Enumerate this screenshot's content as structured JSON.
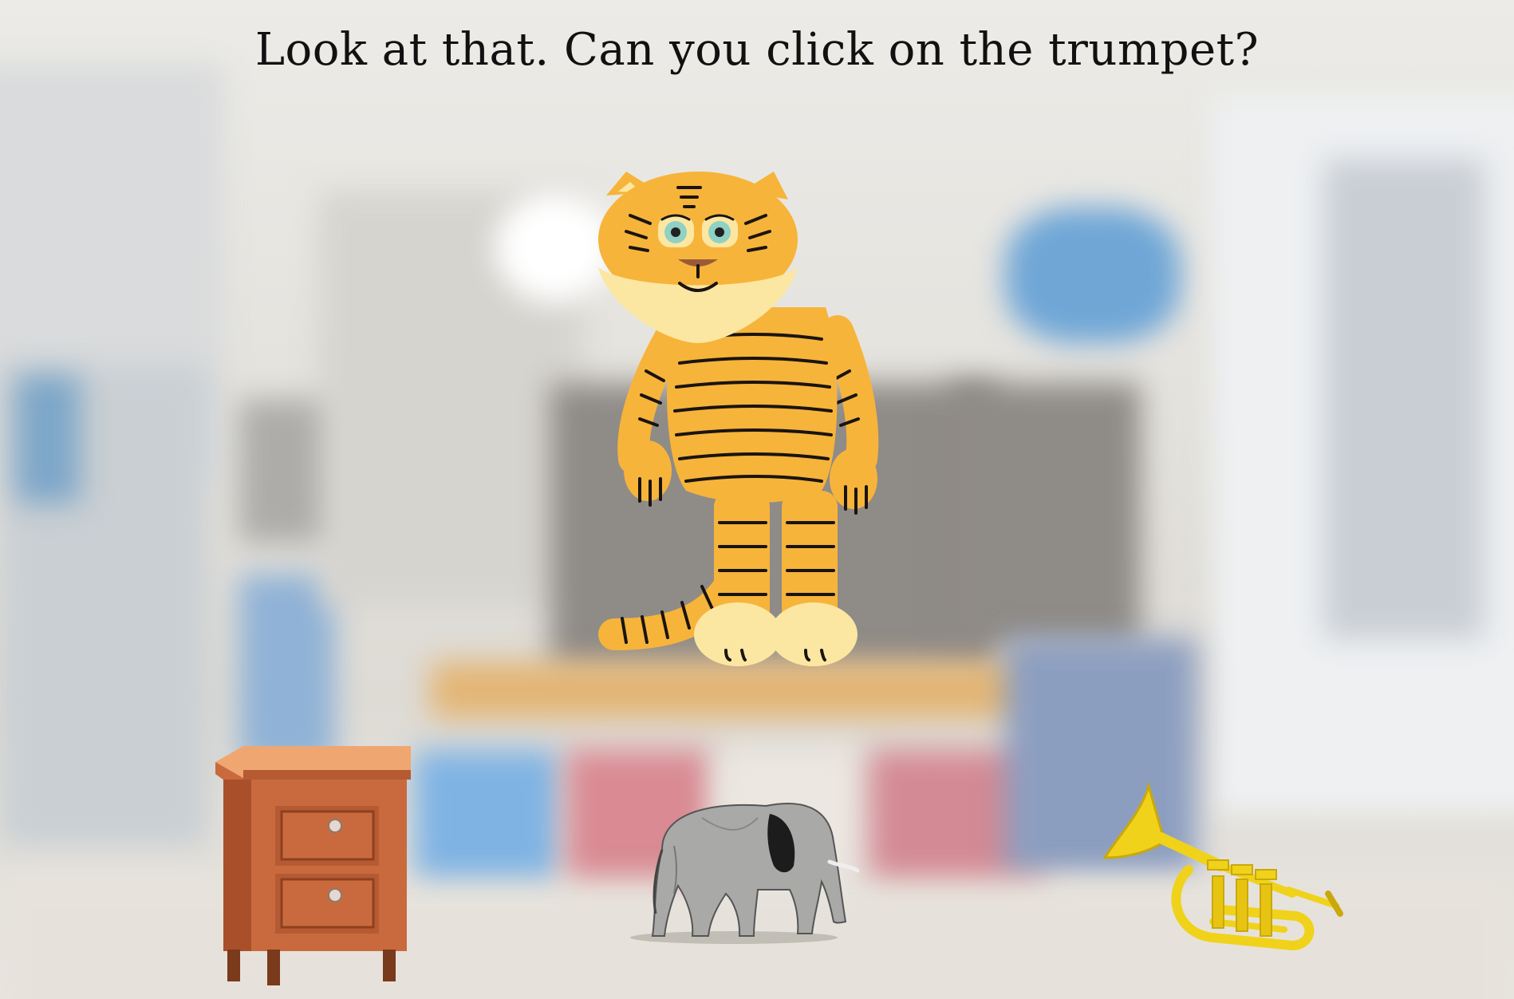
{
  "prompt": "Look at that. Can you click on the trumpet?",
  "objects": [
    {
      "name": "tiger",
      "icon": "tiger-icon"
    },
    {
      "name": "nightstand",
      "icon": "nightstand-icon"
    },
    {
      "name": "elephant",
      "icon": "elephant-icon"
    },
    {
      "name": "trumpet",
      "icon": "trumpet-icon"
    }
  ],
  "colors": {
    "tiger_fur": "#f7b43a",
    "tiger_muzzle": "#fbe7a2",
    "stripe": "#1a1410",
    "wood": "#c96a3e",
    "wood_top": "#f0a670",
    "elephant": "#a9aaa8",
    "trumpet": "#f0d21a"
  }
}
